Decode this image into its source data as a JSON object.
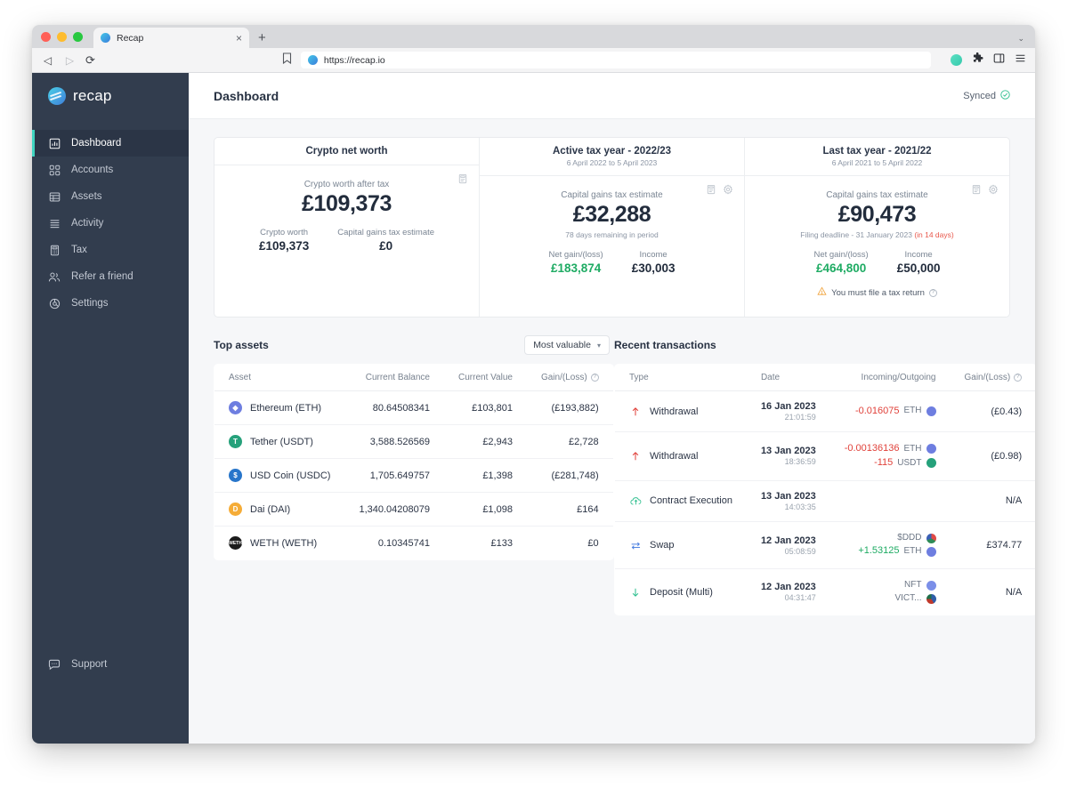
{
  "browser": {
    "tab_title": "Recap",
    "tab_close": "×",
    "new_tab": "+",
    "tabstrip_chevron": "⌄",
    "back": "◁",
    "forward": "▷",
    "reload": "⟳",
    "bookmark_icon": "bookmark-icon",
    "url": "https://recap.io",
    "extensions_icon": "extensions-puzzle-icon",
    "sidepanel_icon": "side-panel-icon",
    "menu_icon": "browser-menu-icon"
  },
  "sidebar": {
    "brand": "recap",
    "items": [
      {
        "label": "Dashboard",
        "icon": "chart-bar-icon",
        "active": true
      },
      {
        "label": "Accounts",
        "icon": "grid-squares-icon",
        "active": false
      },
      {
        "label": "Assets",
        "icon": "table-icon",
        "active": false
      },
      {
        "label": "Activity",
        "icon": "list-lines-icon",
        "active": false
      },
      {
        "label": "Tax",
        "icon": "calculator-icon",
        "active": false
      },
      {
        "label": "Refer a friend",
        "icon": "users-icon",
        "active": false
      },
      {
        "label": "Settings",
        "icon": "gear-circle-icon",
        "active": false
      }
    ],
    "support": {
      "label": "Support",
      "icon": "chat-bubble-icon"
    }
  },
  "header": {
    "title": "Dashboard",
    "sync_status": "Synced",
    "sync_icon": "check-circle-icon"
  },
  "cards": [
    {
      "title": "Crypto net worth",
      "subtitle": "",
      "icons": [
        "report-icon"
      ],
      "main_label": "Crypto worth after tax",
      "main_value": "£109,373",
      "note": "",
      "note_warn": "",
      "pairs": [
        {
          "label": "Crypto worth",
          "value": "£109,373",
          "color": "dark"
        },
        {
          "label": "Capital gains tax estimate",
          "value": "£0",
          "color": "dark"
        }
      ],
      "alert": ""
    },
    {
      "title": "Active tax year - 2022/23",
      "subtitle": "6 April 2022 to 5 April 2023",
      "icons": [
        "report-icon",
        "gear-icon"
      ],
      "main_label": "Capital gains tax estimate",
      "main_value": "£32,288",
      "note": "78 days remaining in period",
      "note_warn": "",
      "pairs": [
        {
          "label": "Net gain/(loss)",
          "value": "£183,874",
          "color": "green"
        },
        {
          "label": "Income",
          "value": "£30,003",
          "color": "dark"
        }
      ],
      "alert": ""
    },
    {
      "title": "Last tax year - 2021/22",
      "subtitle": "6 April 2021 to 5 April 2022",
      "icons": [
        "report-icon",
        "gear-icon"
      ],
      "main_label": "Capital gains tax estimate",
      "main_value": "£90,473",
      "note": "Filing deadline - 31 January 2023 ",
      "note_warn": "(in 14 days)",
      "pairs": [
        {
          "label": "Net gain/(loss)",
          "value": "£464,800",
          "color": "green"
        },
        {
          "label": "Income",
          "value": "£50,000",
          "color": "dark"
        }
      ],
      "alert": "You must file a tax return"
    }
  ],
  "top_assets": {
    "title": "Top assets",
    "sort_value": "Most valuable",
    "columns": [
      "Asset",
      "Current Balance",
      "Current Value",
      "Gain/(Loss)"
    ],
    "rows": [
      {
        "name": "Ethereum (ETH)",
        "symbol": "E",
        "color": "#6e7ee0",
        "balance": "80.64508341",
        "value": "£103,801",
        "gain": "(£193,882)",
        "gain_color": "red"
      },
      {
        "name": "Tether (USDT)",
        "symbol": "T",
        "color": "#26a17b",
        "balance": "3,588.526569",
        "value": "£2,943",
        "gain": "£2,728",
        "gain_color": "green"
      },
      {
        "name": "USD Coin (USDC)",
        "symbol": "$",
        "color": "#2775ca",
        "balance": "1,705.649757",
        "value": "£1,398",
        "gain": "(£281,748)",
        "gain_color": "red"
      },
      {
        "name": "Dai (DAI)",
        "symbol": "D",
        "color": "#f5ac37",
        "balance": "1,340.04208079",
        "value": "£1,098",
        "gain": "£164",
        "gain_color": "green"
      },
      {
        "name": "WETH (WETH)",
        "symbol": "W",
        "color": "#1c1c1c",
        "balance": "0.10345741",
        "value": "£133",
        "gain": "£0",
        "gain_color": "dark"
      }
    ]
  },
  "recent_transactions": {
    "title": "Recent transactions",
    "columns": [
      "Type",
      "Date",
      "Incoming/Outgoing",
      "Gain/(Loss)"
    ],
    "rows": [
      {
        "type": "Withdrawal",
        "icon": "arrow-up-icon",
        "icon_color": "#e0413a",
        "date": "16 Jan 2023",
        "time": "21:01:59",
        "amounts": [
          {
            "text": "-0.016075",
            "unit": "ETH",
            "color": "red",
            "coin": "eth"
          }
        ],
        "gain": "(£0.43)",
        "gain_color": "red"
      },
      {
        "type": "Withdrawal",
        "icon": "arrow-up-icon",
        "icon_color": "#e0413a",
        "date": "13 Jan 2023",
        "time": "18:36:59",
        "amounts": [
          {
            "text": "-0.00136136",
            "unit": "ETH",
            "color": "red",
            "coin": "eth"
          },
          {
            "text": "-115",
            "unit": "USDT",
            "color": "red",
            "coin": "usdt"
          }
        ],
        "gain": "(£0.98)",
        "gain_color": "red"
      },
      {
        "type": "Contract Execution",
        "icon": "cloud-upload-icon",
        "icon_color": "#2fbf8f",
        "date": "13 Jan 2023",
        "time": "14:03:35",
        "amounts": [],
        "gain": "N/A",
        "gain_color": "dark"
      },
      {
        "type": "Swap",
        "icon": "swap-arrows-icon",
        "icon_color": "#4a7fe0",
        "date": "12 Jan 2023",
        "time": "05:08:59",
        "amounts": [
          {
            "text": "",
            "unit": "$DDD",
            "color": "dark",
            "coin": "ddd"
          },
          {
            "text": "+1.53125",
            "unit": "ETH",
            "color": "green",
            "coin": "eth"
          }
        ],
        "gain": "£374.77",
        "gain_color": "green"
      },
      {
        "type": "Deposit (Multi)",
        "icon": "arrow-down-icon",
        "icon_color": "#2fbf8f",
        "date": "12 Jan 2023",
        "time": "04:31:47",
        "amounts": [
          {
            "text": "",
            "unit": "NFT",
            "color": "dark",
            "coin": "nft"
          },
          {
            "text": "",
            "unit": "VICT...",
            "color": "dark",
            "coin": "vict"
          }
        ],
        "gain": "N/A",
        "gain_color": "dark"
      }
    ]
  },
  "colors": {
    "sidebar_bg": "#323d4e",
    "accent_teal": "#3fd4c0",
    "green": "#1eab63",
    "red": "#e0413a",
    "amber": "#f0a33c",
    "page_bg": "#f6f7f9"
  }
}
